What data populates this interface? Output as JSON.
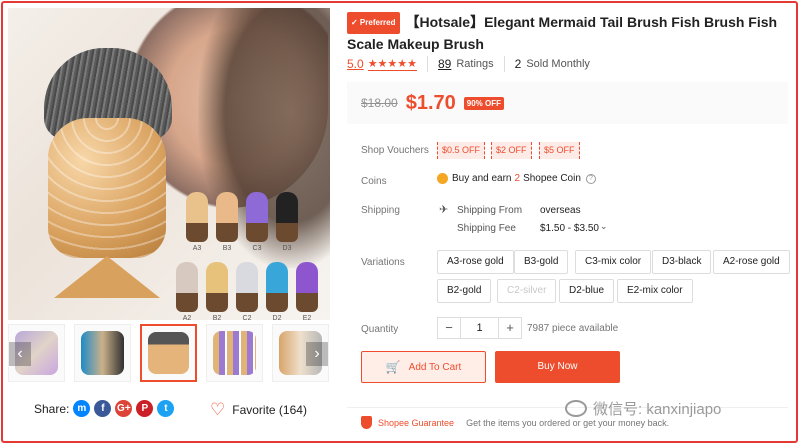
{
  "product": {
    "badge": "✓ Preferred",
    "title": "【Hotsale】Elegant Mermaid Tail Brush Fish Brush Fish Scale Makeup Brush",
    "rating": "5.0",
    "stars": "★★★★★",
    "ratings_count": "89",
    "ratings_label": "Ratings",
    "sold_count": "2",
    "sold_label": "Sold Monthly",
    "old_price": "$18.00",
    "price": "$1.70",
    "discount": "90% OFF"
  },
  "gallery": {
    "swatch_labels": [
      "A3",
      "B3",
      "C3",
      "D3",
      "A2",
      "B2",
      "C2",
      "D2",
      "E2"
    ],
    "swatch_colors": [
      "#e8c28a",
      "#e9b98a",
      "#8e6ad6",
      "#222222",
      "#d8c9c0",
      "#e7c27b",
      "#d9dadf",
      "#39a6d9",
      "#8d56cf"
    ],
    "prev_icon": "‹",
    "next_icon": "›"
  },
  "share": {
    "label": "Share:",
    "icons": [
      "m",
      "f",
      "G+",
      "P",
      "t"
    ],
    "icon_colors": [
      "#0084ff",
      "#3b5998",
      "#db4437",
      "#cb2027",
      "#1da1f2"
    ],
    "favorite": "Favorite (164)"
  },
  "vouchers": {
    "label": "Shop Vouchers",
    "items": [
      "$0.5 OFF",
      "$2 OFF",
      "$5 OFF"
    ]
  },
  "coins": {
    "label": "Coins",
    "prefix": "Buy and earn",
    "amount": "2",
    "suffix": "Shopee Coin",
    "help": "?"
  },
  "shipping": {
    "label": "Shipping",
    "from_label": "Shipping From",
    "from_value": "overseas",
    "fee_label": "Shipping Fee",
    "fee_value": "$1.50 - $3.50",
    "chevron": "⌄"
  },
  "variations": {
    "label": "Variations",
    "options": [
      {
        "label": "A3-rose gold",
        "disabled": false
      },
      {
        "label": "B3-gold",
        "disabled": false
      },
      {
        "label": "C3-mix color",
        "disabled": false
      },
      {
        "label": "D3-black",
        "disabled": false
      },
      {
        "label": "A2-rose gold",
        "disabled": false
      },
      {
        "label": "B2-gold",
        "disabled": false
      },
      {
        "label": "C2-silver",
        "disabled": true
      },
      {
        "label": "D2-blue",
        "disabled": false
      },
      {
        "label": "E2-mix color",
        "disabled": false
      }
    ]
  },
  "quantity": {
    "label": "Quantity",
    "minus": "−",
    "value": "1",
    "plus": "+",
    "available": "7987 piece available"
  },
  "actions": {
    "add_to_cart": "Add To Cart",
    "buy_now": "Buy Now"
  },
  "guarantee": {
    "title": "Shopee Guarantee",
    "text": "Get the items you ordered or get your money back."
  },
  "watermark": {
    "text": "微信号: kanxinjiapo"
  }
}
